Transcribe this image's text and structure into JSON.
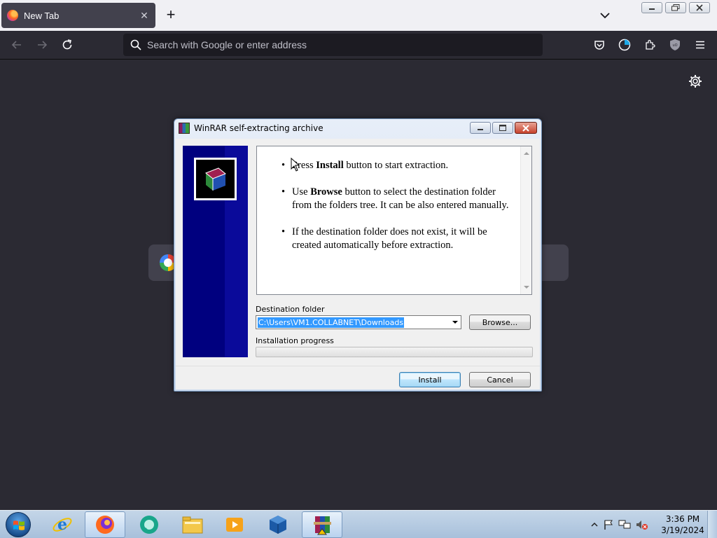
{
  "browser": {
    "tab": {
      "title": "New Tab"
    },
    "newtab_symbol": "+",
    "urlbar": {
      "placeholder": "Search with Google or enter address"
    }
  },
  "dialog": {
    "title": "WinRAR self-extracting archive",
    "info": [
      {
        "pre": "Press ",
        "bold": "Install",
        "post": " button to start extraction."
      },
      {
        "pre": "Use ",
        "bold": "Browse",
        "post": " button to select the destination folder from the folders tree. It can be also entered manually."
      },
      {
        "pre": "",
        "bold": "",
        "post": "If the destination folder does not exist, it will be created automatically before extraction."
      }
    ],
    "destination_label": "Destination folder",
    "destination_value": "C:\\Users\\VM1.COLLABNET\\Downloads",
    "browse_label": "Browse...",
    "progress_label": "Installation progress",
    "progress": 0,
    "install_label": "Install",
    "cancel_label": "Cancel"
  },
  "taskbar": {
    "pinned": [
      "internet-explorer-icon",
      "firefox-icon",
      "chat-app-icon",
      "file-explorer-icon",
      "media-player-icon",
      "virtualbox-icon",
      "winrar-icon"
    ],
    "clock_time": "3:36 PM",
    "clock_date": "3/19/2024"
  }
}
